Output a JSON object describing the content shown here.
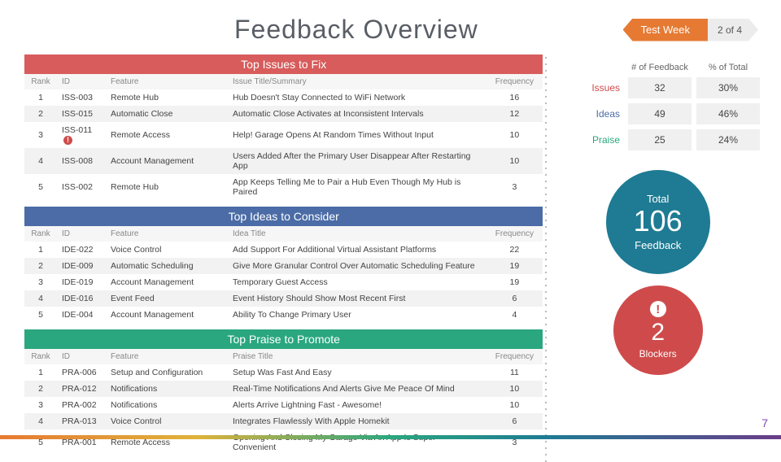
{
  "header": {
    "title": "Feedback Overview",
    "testweek_label": "Test Week",
    "testweek_position": "2 of 4"
  },
  "page_number": "7",
  "columns": {
    "rank": "Rank",
    "id": "ID",
    "feature": "Feature",
    "issue_title": "Issue Title/Summary",
    "idea_title": "Idea Title",
    "praise_title": "Praise Title",
    "frequency": "Frequency"
  },
  "sections": {
    "issues": {
      "heading": "Top Issues to Fix",
      "rows": [
        {
          "rank": "1",
          "id": "ISS-003",
          "feature": "Remote Hub",
          "title": "Hub Doesn't Stay Connected to WiFi Network",
          "freq": "16",
          "blocker": false
        },
        {
          "rank": "2",
          "id": "ISS-015",
          "feature": "Automatic Close",
          "title": "Automatic Close Activates at Inconsistent Intervals",
          "freq": "12",
          "blocker": false
        },
        {
          "rank": "3",
          "id": "ISS-011",
          "feature": "Remote Access",
          "title": "Help! Garage Opens At Random Times Without Input",
          "freq": "10",
          "blocker": true
        },
        {
          "rank": "4",
          "id": "ISS-008",
          "feature": "Account Management",
          "title": "Users Added After the Primary User Disappear After Restarting App",
          "freq": "10",
          "blocker": false
        },
        {
          "rank": "5",
          "id": "ISS-002",
          "feature": "Remote Hub",
          "title": "App Keeps Telling Me to Pair a Hub Even Though My Hub is Paired",
          "freq": "3",
          "blocker": false
        }
      ]
    },
    "ideas": {
      "heading": "Top Ideas to Consider",
      "rows": [
        {
          "rank": "1",
          "id": "IDE-022",
          "feature": "Voice Control",
          "title": "Add Support For Additional Virtual Assistant Platforms",
          "freq": "22"
        },
        {
          "rank": "2",
          "id": "IDE-009",
          "feature": "Automatic Scheduling",
          "title": "Give More Granular Control Over Automatic Scheduling Feature",
          "freq": "19"
        },
        {
          "rank": "3",
          "id": "IDE-019",
          "feature": "Account Management",
          "title": "Temporary Guest Access",
          "freq": "19"
        },
        {
          "rank": "4",
          "id": "IDE-016",
          "feature": "Event Feed",
          "title": "Event History Should Show Most Recent First",
          "freq": "6"
        },
        {
          "rank": "5",
          "id": "IDE-004",
          "feature": "Account Management",
          "title": "Ability To Change Primary User",
          "freq": "4"
        }
      ]
    },
    "praise": {
      "heading": "Top Praise to Promote",
      "rows": [
        {
          "rank": "1",
          "id": "PRA-006",
          "feature": "Setup and Configuration",
          "title": "Setup Was Fast And Easy",
          "freq": "11"
        },
        {
          "rank": "2",
          "id": "PRA-012",
          "feature": "Notifications",
          "title": "Real-Time Notifications And Alerts Give Me Peace Of Mind",
          "freq": "10"
        },
        {
          "rank": "3",
          "id": "PRA-002",
          "feature": "Notifications",
          "title": "Alerts Arrive Lightning Fast - Awesome!",
          "freq": "10"
        },
        {
          "rank": "4",
          "id": "PRA-013",
          "feature": "Voice Control",
          "title": "Integrates Flawlessly With Apple Homekit",
          "freq": "6"
        },
        {
          "rank": "5",
          "id": "PRA-001",
          "feature": "Remote Access",
          "title": "Opening And Closing My Garage Via An App Is Super Convenient",
          "freq": "3"
        }
      ]
    }
  },
  "summary": {
    "col_count": "# of Feedback",
    "col_pct": "% of Total",
    "rows": {
      "issues": {
        "label": "Issues",
        "count": "32",
        "pct": "30%"
      },
      "ideas": {
        "label": "Ideas",
        "count": "49",
        "pct": "46%"
      },
      "praise": {
        "label": "Praise",
        "count": "25",
        "pct": "24%"
      }
    },
    "total": {
      "label_top": "Total",
      "value": "106",
      "label_bottom": "Feedback"
    },
    "blockers": {
      "value": "2",
      "label": "Blockers"
    }
  }
}
